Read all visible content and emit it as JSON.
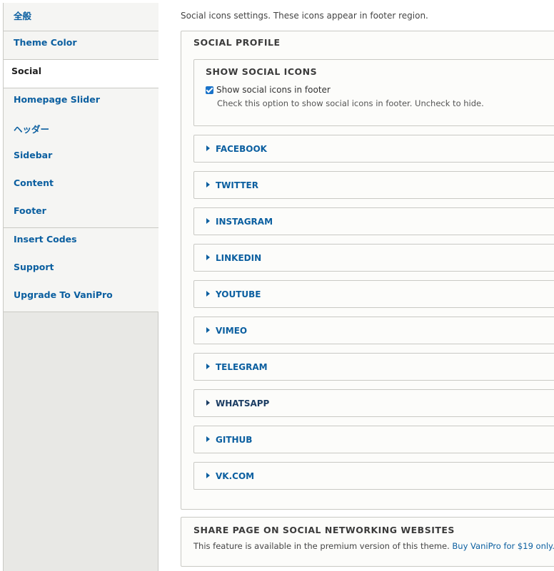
{
  "sidebar": {
    "tabs": [
      {
        "label": "全般"
      },
      {
        "label": "Theme Color"
      },
      {
        "label": "Social"
      },
      {
        "label": "Homepage Slider"
      },
      {
        "label": "ヘッダー"
      },
      {
        "label": "Sidebar"
      },
      {
        "label": "Content"
      },
      {
        "label": "Footer"
      },
      {
        "label": "Insert Codes"
      },
      {
        "label": "Support"
      },
      {
        "label": "Upgrade To VaniPro"
      }
    ],
    "active_tab": "Social"
  },
  "main": {
    "intro": "Social icons settings. These icons appear in footer region.",
    "social_profile": {
      "legend": "SOCIAL PROFILE",
      "show_icons": {
        "legend": "SHOW SOCIAL ICONS",
        "checkbox_label": "Show social icons in footer",
        "checked": true,
        "description": "Check this option to show social icons in footer. Uncheck to hide."
      },
      "networks": [
        {
          "label": "FACEBOOK"
        },
        {
          "label": "TWITTER"
        },
        {
          "label": "INSTAGRAM"
        },
        {
          "label": "LINKEDIN"
        },
        {
          "label": "YOUTUBE"
        },
        {
          "label": "VIMEO"
        },
        {
          "label": "TELEGRAM"
        },
        {
          "label": "WHATSAPP"
        },
        {
          "label": "GITHUB"
        },
        {
          "label": "VK.COM"
        }
      ]
    },
    "share": {
      "legend": "SHARE PAGE ON SOCIAL NETWORKING WEBSITES",
      "text": "This feature is available in the premium version of this theme.",
      "link_text": "Buy VaniPro for $19 only."
    }
  },
  "colors": {
    "link": "#0b5fa0",
    "checkbox": "#1a73c9",
    "border": "#c9c9c4",
    "sidebar_bg": "#e8e8e5"
  }
}
